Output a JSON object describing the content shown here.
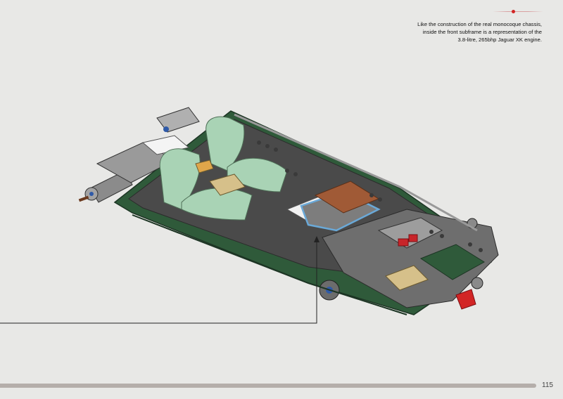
{
  "caption": {
    "lines": [
      "Like the construction of the real monocoque chassis,",
      "inside the front subframe is a representation of the",
      "3.8-litre, 265bhp Jaguar XK engine."
    ]
  },
  "page_number": "115",
  "colors": {
    "accent_red": "#d22525",
    "progress_bar": "#b5aeaa",
    "chassis_green": "#2f5a3a",
    "seat_green": "#a9d3b5",
    "engine_blue": "#6aa9d8",
    "engine_brown": "#a05a36"
  },
  "illustration": {
    "name": "lego-jaguar-chassis-engine-render"
  }
}
